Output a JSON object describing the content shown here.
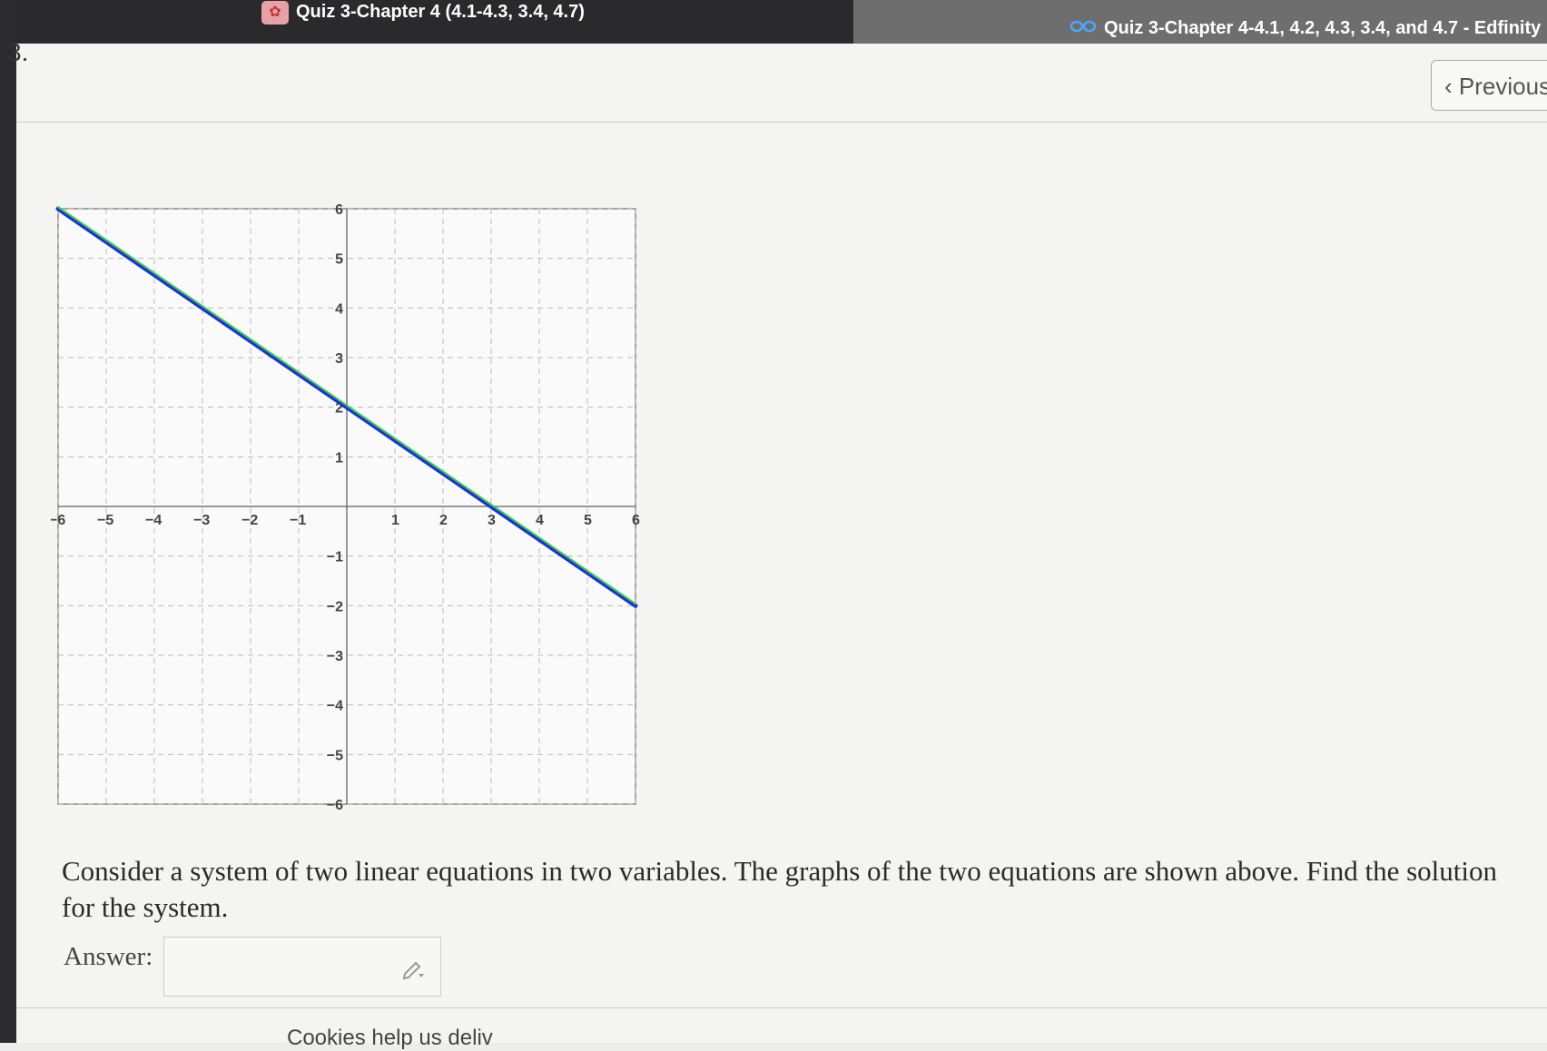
{
  "tabs": {
    "left_title": "Quiz 3-Chapter 4 (4.1-4.3, 3.4, 4.7)",
    "right_title": "Quiz 3-Chapter 4-4.1, 4.2, 4.3, 3.4, and 4.7 - Edfinity"
  },
  "question": {
    "number": "3.",
    "text": "Consider a system of two linear equations in two variables. The graphs of the two equations are shown above. Find the solution for the system.",
    "answer_label": "Answer:",
    "answer_value": "",
    "answer_placeholder": ""
  },
  "nav": {
    "previous_label": "Previous"
  },
  "footer": {
    "cookie_text": "Cookies help us deliv"
  },
  "colors": {
    "line1": "#1d33d6",
    "line2": "#3ecf4a"
  },
  "chart_data": {
    "type": "line",
    "xlim": [
      -6,
      6
    ],
    "ylim": [
      -6,
      6
    ],
    "grid": true,
    "x_ticks": [
      -6,
      -5,
      -4,
      -3,
      -2,
      -1,
      1,
      2,
      3,
      4,
      5,
      6
    ],
    "y_ticks": [
      -6,
      -5,
      -4,
      -3,
      -2,
      -1,
      1,
      2,
      3,
      4,
      5,
      6
    ],
    "series": [
      {
        "x": [
          -6,
          6
        ],
        "y": [
          6,
          -2
        ],
        "color": "#1d33d6"
      },
      {
        "x": [
          -6,
          6
        ],
        "y": [
          6,
          -2
        ],
        "color": "#3ecf4a"
      }
    ]
  }
}
